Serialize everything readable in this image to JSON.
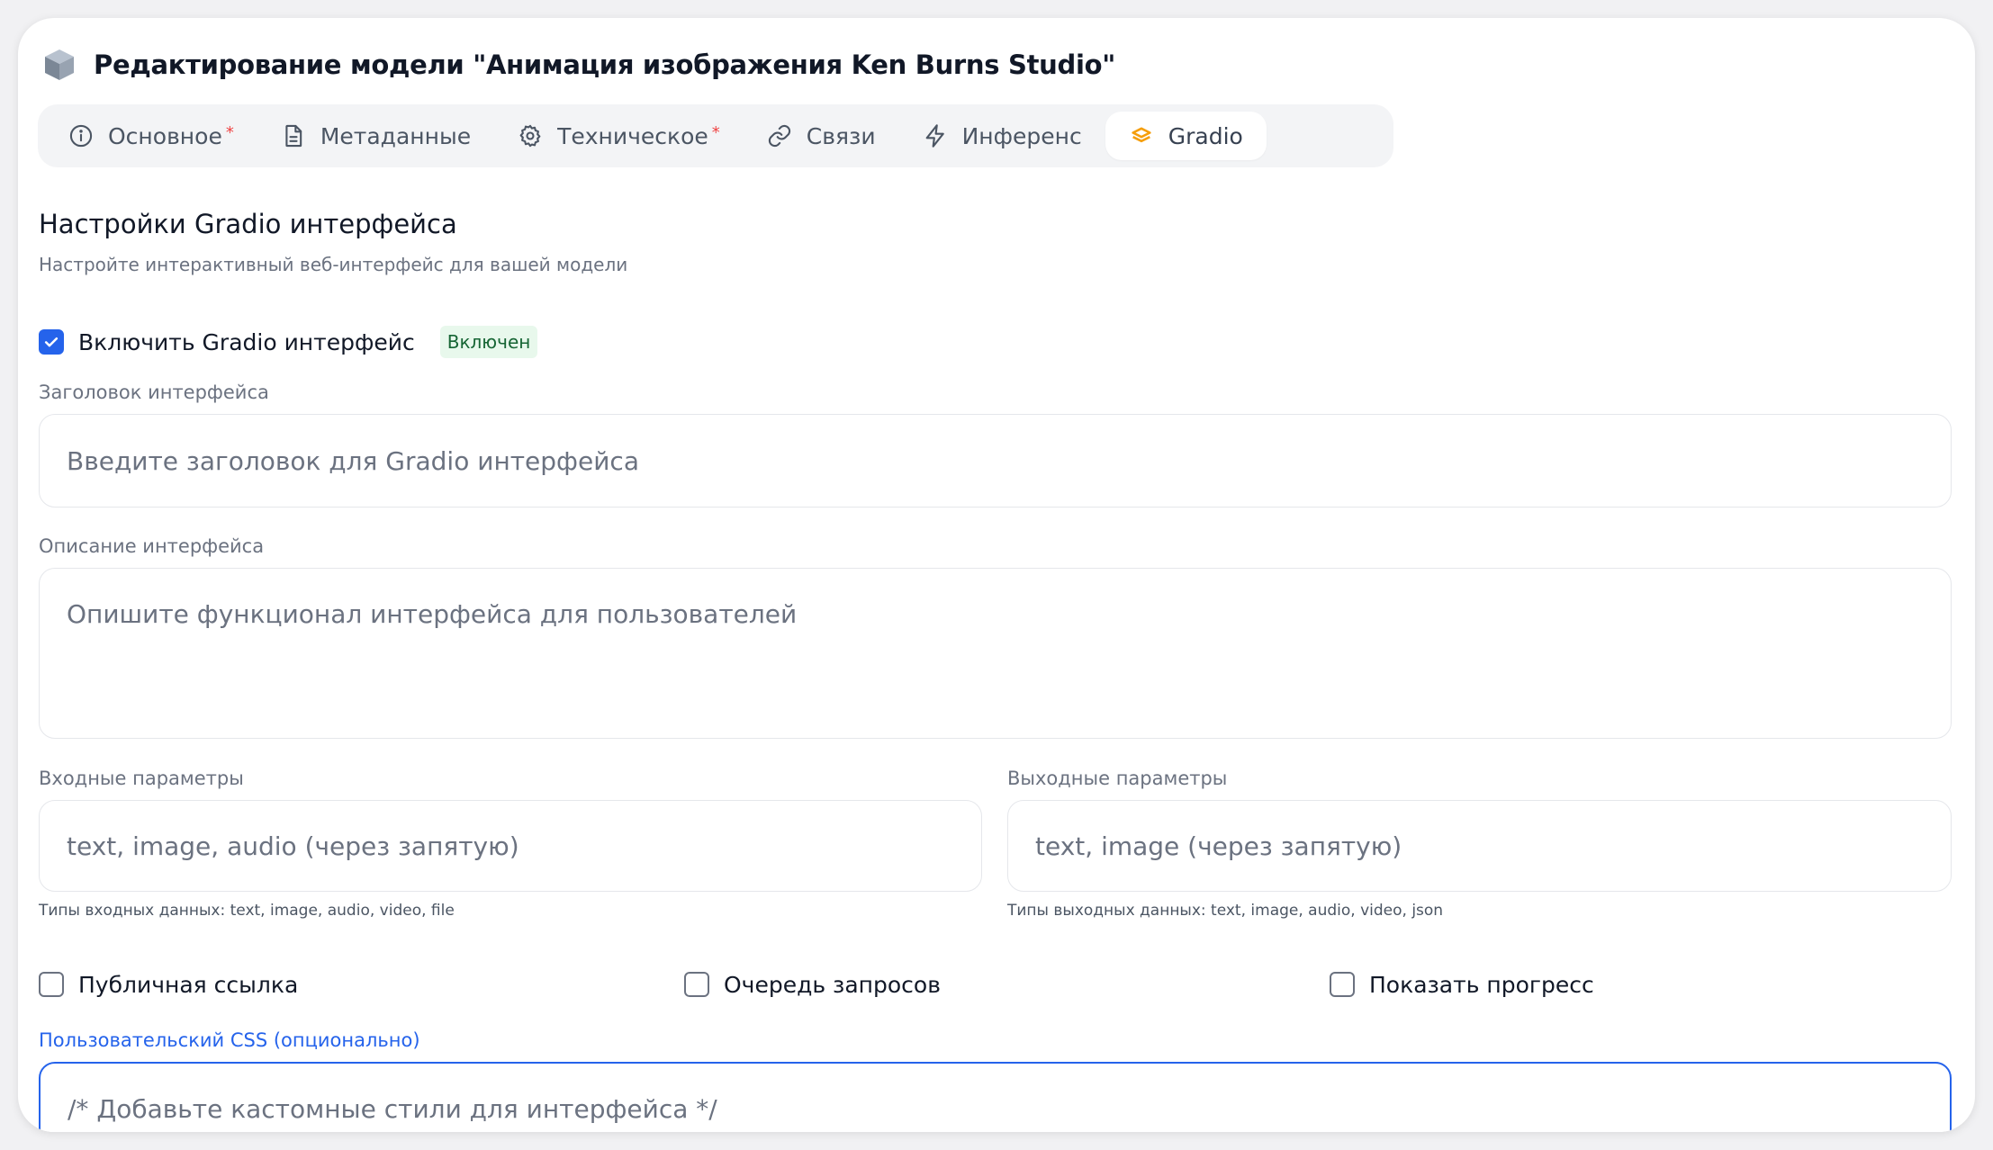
{
  "window": {
    "title": "Редактирование модели \"Анимация изображения Ken Burns Studio\""
  },
  "tabs": [
    {
      "label": "Основное",
      "icon": "info-icon",
      "required": true,
      "active": false
    },
    {
      "label": "Метаданные",
      "icon": "document-icon",
      "required": false,
      "active": false
    },
    {
      "label": "Техническое",
      "icon": "gear-icon",
      "required": true,
      "active": false
    },
    {
      "label": "Связи",
      "icon": "link-icon",
      "required": false,
      "active": false
    },
    {
      "label": "Инференс",
      "icon": "lightning-icon",
      "required": false,
      "active": false
    },
    {
      "label": "Gradio",
      "icon": "gradio-icon",
      "required": false,
      "active": true
    }
  ],
  "required_marker": "*",
  "section": {
    "title": "Настройки Gradio интерфейса",
    "subtitle": "Настройте интерактивный веб-интерфейс для вашей модели"
  },
  "enable": {
    "label": "Включить Gradio интерфейс",
    "checked": true,
    "status_badge": "Включен"
  },
  "fields": {
    "title": {
      "label": "Заголовок интерфейса",
      "value": "",
      "placeholder": "Введите заголовок для Gradio интерфейса"
    },
    "description": {
      "label": "Описание интерфейса",
      "value": "",
      "placeholder": "Опишите функционал интерфейса для пользователей"
    },
    "inputs": {
      "label": "Входные параметры",
      "value": "",
      "placeholder": "text, image, audio (через запятую)",
      "hint": "Типы входных данных: text, image, audio, video, file"
    },
    "outputs": {
      "label": "Выходные параметры",
      "value": "",
      "placeholder": "text, image (через запятую)",
      "hint": "Типы выходных данных: text, image, audio, video, json"
    },
    "custom_css": {
      "label": "Пользовательский CSS (опционально)",
      "value": "",
      "placeholder": "/* Добавьте кастомные стили для интерфейса */"
    }
  },
  "options": [
    {
      "label": "Публичная ссылка",
      "checked": false
    },
    {
      "label": "Очередь запросов",
      "checked": false
    },
    {
      "label": "Показать прогресс",
      "checked": false
    }
  ],
  "colors": {
    "accent": "#2563eb",
    "required": "#ef4444",
    "gradio": "#f59e0b",
    "badge_bg": "#e8f8ec",
    "badge_text": "#166534"
  }
}
